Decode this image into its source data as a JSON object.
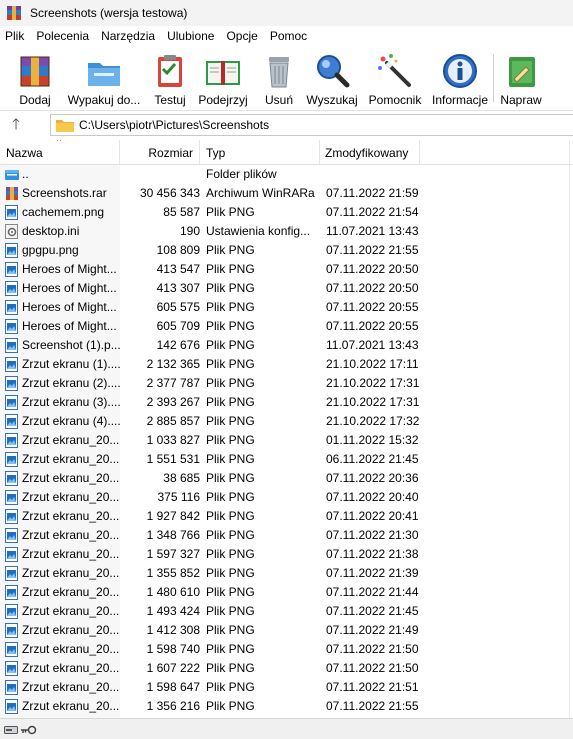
{
  "window": {
    "title": "Screenshots (wersja testowa)"
  },
  "menu": [
    "Plik",
    "Polecenia",
    "Narzędzia",
    "Ulubione",
    "Opcje",
    "Pomoc"
  ],
  "toolbar": [
    {
      "label": "Dodaj",
      "icon": "add-archive-icon"
    },
    {
      "label": "Wypakuj do...",
      "icon": "extract-icon"
    },
    {
      "label": "Testuj",
      "icon": "test-icon"
    },
    {
      "label": "Podejrzyj",
      "icon": "view-icon"
    },
    {
      "label": "Usuń",
      "icon": "delete-icon"
    },
    {
      "label": "Wyszukaj",
      "icon": "find-icon"
    },
    {
      "label": "Pomocnik",
      "icon": "wizard-icon"
    },
    {
      "label": "Informacje",
      "icon": "info-icon"
    },
    {
      "label": "Napraw",
      "icon": "repair-icon"
    }
  ],
  "address": {
    "path": "C:\\Users\\piotr\\Pictures\\Screenshots"
  },
  "columns": {
    "name": "Nazwa",
    "size": "Rozmiar",
    "type": "Typ",
    "modified": "Zmodyfikowany"
  },
  "files": [
    {
      "name": "..",
      "size": "",
      "type": "Folder plików",
      "modified": "",
      "icon": "parent-folder-icon"
    },
    {
      "name": "Screenshots.rar",
      "size": "30 456 343",
      "type": "Archiwum WinRARa",
      "modified": "07.11.2022 21:59",
      "icon": "rar-file-icon"
    },
    {
      "name": "cachemem.png",
      "size": "85 587",
      "type": "Plik PNG",
      "modified": "07.11.2022 21:54",
      "icon": "png-file-icon"
    },
    {
      "name": "desktop.ini",
      "size": "190",
      "type": "Ustawienia konfig...",
      "modified": "11.07.2021 13:43",
      "icon": "ini-file-icon"
    },
    {
      "name": "gpgpu.png",
      "size": "108 809",
      "type": "Plik PNG",
      "modified": "07.11.2022 21:55",
      "icon": "png-file-icon"
    },
    {
      "name": "Heroes of Might...",
      "size": "413 547",
      "type": "Plik PNG",
      "modified": "07.11.2022 20:50",
      "icon": "png-file-icon"
    },
    {
      "name": "Heroes of Might...",
      "size": "413 307",
      "type": "Plik PNG",
      "modified": "07.11.2022 20:50",
      "icon": "png-file-icon"
    },
    {
      "name": "Heroes of Might...",
      "size": "605 575",
      "type": "Plik PNG",
      "modified": "07.11.2022 20:55",
      "icon": "png-file-icon"
    },
    {
      "name": "Heroes of Might...",
      "size": "605 709",
      "type": "Plik PNG",
      "modified": "07.11.2022 20:55",
      "icon": "png-file-icon"
    },
    {
      "name": "Screenshot (1).p...",
      "size": "142 676",
      "type": "Plik PNG",
      "modified": "11.07.2021 13:43",
      "icon": "png-file-icon"
    },
    {
      "name": "Zrzut ekranu (1)....",
      "size": "2 132 365",
      "type": "Plik PNG",
      "modified": "21.10.2022 17:11",
      "icon": "png-file-icon"
    },
    {
      "name": "Zrzut ekranu (2)....",
      "size": "2 377 787",
      "type": "Plik PNG",
      "modified": "21.10.2022 17:31",
      "icon": "png-file-icon"
    },
    {
      "name": "Zrzut ekranu (3)....",
      "size": "2 393 267",
      "type": "Plik PNG",
      "modified": "21.10.2022 17:31",
      "icon": "png-file-icon"
    },
    {
      "name": "Zrzut ekranu (4)....",
      "size": "2 885 857",
      "type": "Plik PNG",
      "modified": "21.10.2022 17:32",
      "icon": "png-file-icon"
    },
    {
      "name": "Zrzut ekranu_20...",
      "size": "1 033 827",
      "type": "Plik PNG",
      "modified": "01.11.2022 15:32",
      "icon": "png-file-icon"
    },
    {
      "name": "Zrzut ekranu_20...",
      "size": "1 551 531",
      "type": "Plik PNG",
      "modified": "06.11.2022 21:45",
      "icon": "png-file-icon"
    },
    {
      "name": "Zrzut ekranu_20...",
      "size": "38 685",
      "type": "Plik PNG",
      "modified": "07.11.2022 20:36",
      "icon": "png-file-icon"
    },
    {
      "name": "Zrzut ekranu_20...",
      "size": "375 116",
      "type": "Plik PNG",
      "modified": "07.11.2022 20:40",
      "icon": "png-file-icon"
    },
    {
      "name": "Zrzut ekranu_20...",
      "size": "1 927 842",
      "type": "Plik PNG",
      "modified": "07.11.2022 20:41",
      "icon": "png-file-icon"
    },
    {
      "name": "Zrzut ekranu_20...",
      "size": "1 348 766",
      "type": "Plik PNG",
      "modified": "07.11.2022 21:30",
      "icon": "png-file-icon"
    },
    {
      "name": "Zrzut ekranu_20...",
      "size": "1 597 327",
      "type": "Plik PNG",
      "modified": "07.11.2022 21:38",
      "icon": "png-file-icon"
    },
    {
      "name": "Zrzut ekranu_20...",
      "size": "1 355 852",
      "type": "Plik PNG",
      "modified": "07.11.2022 21:39",
      "icon": "png-file-icon"
    },
    {
      "name": "Zrzut ekranu_20...",
      "size": "1 480 610",
      "type": "Plik PNG",
      "modified": "07.11.2022 21:44",
      "icon": "png-file-icon"
    },
    {
      "name": "Zrzut ekranu_20...",
      "size": "1 493 424",
      "type": "Plik PNG",
      "modified": "07.11.2022 21:45",
      "icon": "png-file-icon"
    },
    {
      "name": "Zrzut ekranu_20...",
      "size": "1 412 308",
      "type": "Plik PNG",
      "modified": "07.11.2022 21:49",
      "icon": "png-file-icon"
    },
    {
      "name": "Zrzut ekranu_20...",
      "size": "1 598 740",
      "type": "Plik PNG",
      "modified": "07.11.2022 21:50",
      "icon": "png-file-icon"
    },
    {
      "name": "Zrzut ekranu_20...",
      "size": "1 607 222",
      "type": "Plik PNG",
      "modified": "07.11.2022 21:50",
      "icon": "png-file-icon"
    },
    {
      "name": "Zrzut ekranu_20...",
      "size": "1 598 647",
      "type": "Plik PNG",
      "modified": "07.11.2022 21:51",
      "icon": "png-file-icon"
    },
    {
      "name": "Zrzut ekranu_20...",
      "size": "1 356 216",
      "type": "Plik PNG",
      "modified": "07.11.2022 21:55",
      "icon": "png-file-icon"
    }
  ],
  "statusbar": {
    "icons": [
      "drive-icon",
      "key-icon"
    ]
  },
  "colors": {
    "titlebar": "#f3f3f3",
    "folder": "#f6c94a",
    "png_icon": "#1e6fc1",
    "rar_red": "#b22b2b"
  }
}
